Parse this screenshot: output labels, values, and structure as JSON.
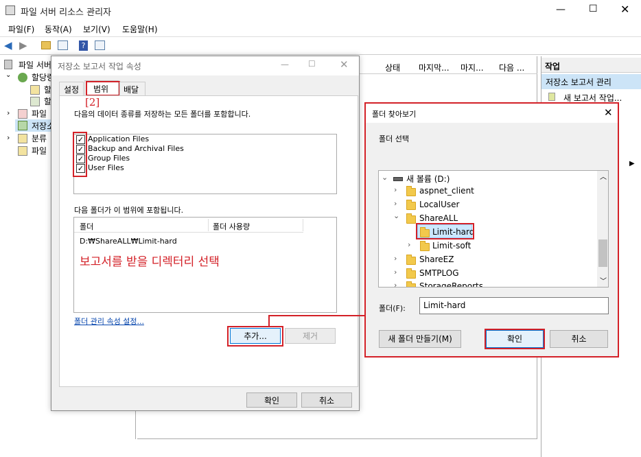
{
  "app": {
    "title": "파일 서버 리소스 관리자",
    "menu": [
      "파일(F)",
      "동작(A)",
      "보기(V)",
      "도움말(H)"
    ]
  },
  "tree": {
    "root": "파일 서버",
    "items": [
      "할당량",
      "할",
      "할",
      "파일",
      "저장소",
      "분류",
      "파일"
    ]
  },
  "columns": [
    "상태",
    "마지막...",
    "마지...",
    "다음 ..."
  ],
  "actions": {
    "header": "작업",
    "selected": "저장소 보고서 관리",
    "item1": "새 보고서 작업..."
  },
  "props_dialog": {
    "title": "저장소 보고서 작업 속성",
    "tabs": [
      "설정",
      "범위",
      "배달"
    ],
    "annotation": "[2]",
    "description": "다음의 데이터 종류를 저장하는 모든 폴더를 포함합니다.",
    "data_types": [
      "Application Files",
      "Backup and Archival Files",
      "Group Files",
      "User Files"
    ],
    "folders_label": "다음 폴더가 이 범위에 포함됩니다.",
    "col_folder": "폴더",
    "col_usage": "폴더 사용량",
    "folder_row": "D:₩ShareALL₩Limit-hard",
    "overlay_text": "보고서를 받을 디렉터리 선택",
    "link": "폴더 관리 속성 설정...",
    "add": "추가...",
    "remove": "제거",
    "ok": "확인",
    "cancel": "취소"
  },
  "browse_dialog": {
    "title": "폴더 찾아보기",
    "select_label": "폴더 선택",
    "drive": "새 볼륨 (D:)",
    "folders": [
      "aspnet_client",
      "LocalUser",
      "ShareALL",
      "Limit-hard",
      "Limit-soft",
      "ShareEZ",
      "SMTPLOG",
      "StorageReports"
    ],
    "folder_label": "폴더(F):",
    "folder_value": "Limit-hard",
    "new_folder": "새 폴더 만들기(M)",
    "ok": "확인",
    "cancel": "취소"
  },
  "colors": {
    "annotation": "#d32027",
    "accent": "#0078d7",
    "link": "#0645ad"
  }
}
